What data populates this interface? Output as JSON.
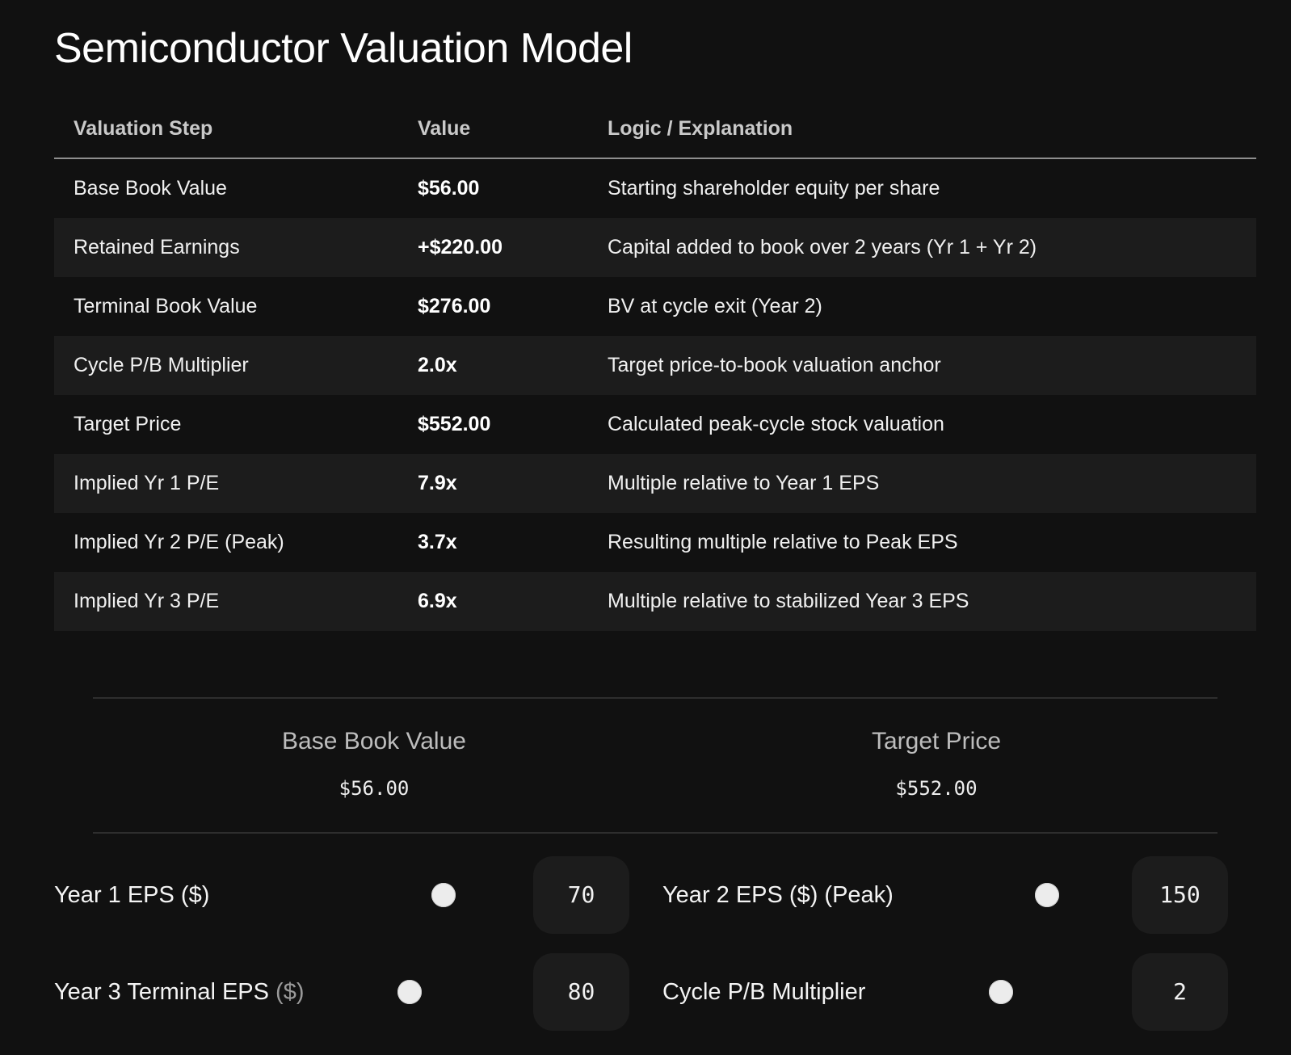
{
  "title": "Semiconductor Valuation Model",
  "table": {
    "headers": [
      "Valuation Step",
      "Value",
      "Logic / Explanation"
    ],
    "rows": [
      {
        "step": "Base Book Value",
        "value": "$56.00",
        "logic": "Starting shareholder equity per share"
      },
      {
        "step": "Retained Earnings",
        "value": "+$220.00",
        "logic": "Capital added to book over 2 years (Yr 1 + Yr 2)"
      },
      {
        "step": "Terminal Book Value",
        "value": "$276.00",
        "logic": "BV at cycle exit (Year 2)"
      },
      {
        "step": "Cycle P/B Multiplier",
        "value": "2.0x",
        "logic": "Target price-to-book valuation anchor"
      },
      {
        "step": "Target Price",
        "value": "$552.00",
        "logic": "Calculated peak-cycle stock valuation"
      },
      {
        "step": "Implied Yr 1 P/E",
        "value": "7.9x",
        "logic": "Multiple relative to Year 1 EPS"
      },
      {
        "step": "Implied Yr 2 P/E (Peak)",
        "value": "3.7x",
        "logic": "Resulting multiple relative to Peak EPS"
      },
      {
        "step": "Implied Yr 3 P/E",
        "value": "6.9x",
        "logic": "Multiple relative to stabilized Year 3 EPS"
      }
    ]
  },
  "summary": {
    "base_book_label": "Base Book Value",
    "base_book_value": "$56.00",
    "target_price_label": "Target Price",
    "target_price_value": "$552.00"
  },
  "controls": {
    "year1": {
      "label": "Year 1 EPS ($)",
      "value": "70"
    },
    "year2": {
      "label": "Year 2 EPS ($) (Peak)",
      "value": "150"
    },
    "year3": {
      "label": "Year 3 Terminal EPS",
      "label_suffix": "($)",
      "value": "80"
    },
    "pb": {
      "label": "Cycle P/B Multiplier",
      "value": "2"
    }
  }
}
